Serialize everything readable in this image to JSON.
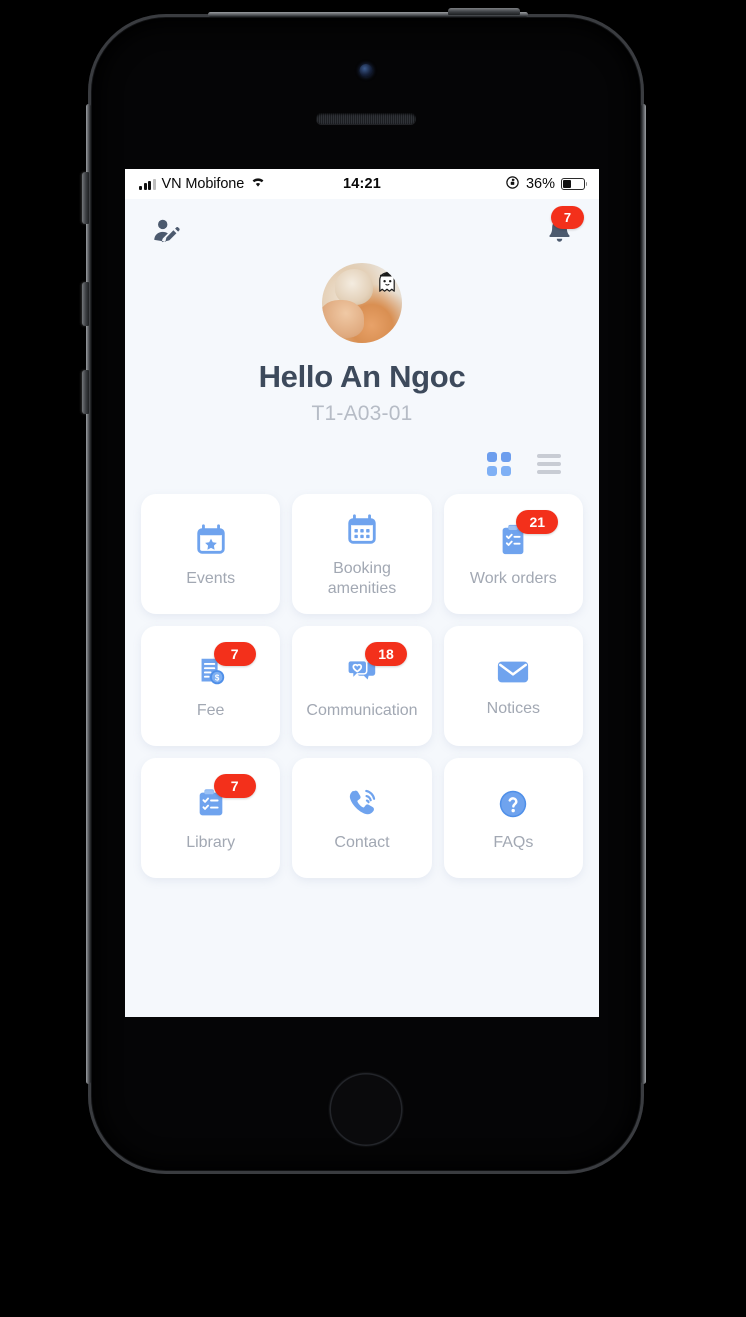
{
  "status_bar": {
    "carrier": "VN Mobifone",
    "time": "14:21",
    "battery_percent": "36%",
    "signal_icon": "signal-bars-icon",
    "wifi_icon": "wifi-icon",
    "rotation_lock_icon": "rotation-lock-icon",
    "battery_icon": "battery-icon"
  },
  "top_bar": {
    "profile_edit_icon": "profile-edit-icon",
    "notification_icon": "bell-icon",
    "notification_badge": "7"
  },
  "profile": {
    "avatar_icon": "user-avatar",
    "greeting": "Hello An Ngoc",
    "unit_code": "T1-A03-01"
  },
  "view_toggle": {
    "grid_icon": "grid-view-icon",
    "list_icon": "list-view-icon",
    "active": "grid"
  },
  "tiles": [
    {
      "label": "Events",
      "icon": "calendar-star-icon",
      "badge": null
    },
    {
      "label": "Booking\namenities",
      "label_line1": "Booking",
      "label_line2": "amenities",
      "icon": "calendar-grid-icon",
      "badge": null
    },
    {
      "label": "Work orders",
      "icon": "clipboard-check-icon",
      "badge": "21"
    },
    {
      "label": "Fee",
      "icon": "invoice-dollar-icon",
      "badge": "7"
    },
    {
      "label": "Communication",
      "icon": "chat-heart-icon",
      "badge": "18"
    },
    {
      "label": "Notices",
      "icon": "envelope-icon",
      "badge": null
    },
    {
      "label": "Library",
      "icon": "clipboard-list-icon",
      "badge": "7"
    },
    {
      "label": "Contact",
      "icon": "phone-ring-icon",
      "badge": null
    },
    {
      "label": "FAQs",
      "icon": "question-circle-icon",
      "badge": null
    }
  ],
  "colors": {
    "screen_bg": "#f5f8fc",
    "card_bg": "#ffffff",
    "icon_blue": "#6fa3ee",
    "badge_red": "#f3301b",
    "heading": "#3d4a5c",
    "muted_text": "#a2a8b3",
    "subtitle": "#b6bcc6",
    "toolbar_icon": "#4c5a6e"
  }
}
